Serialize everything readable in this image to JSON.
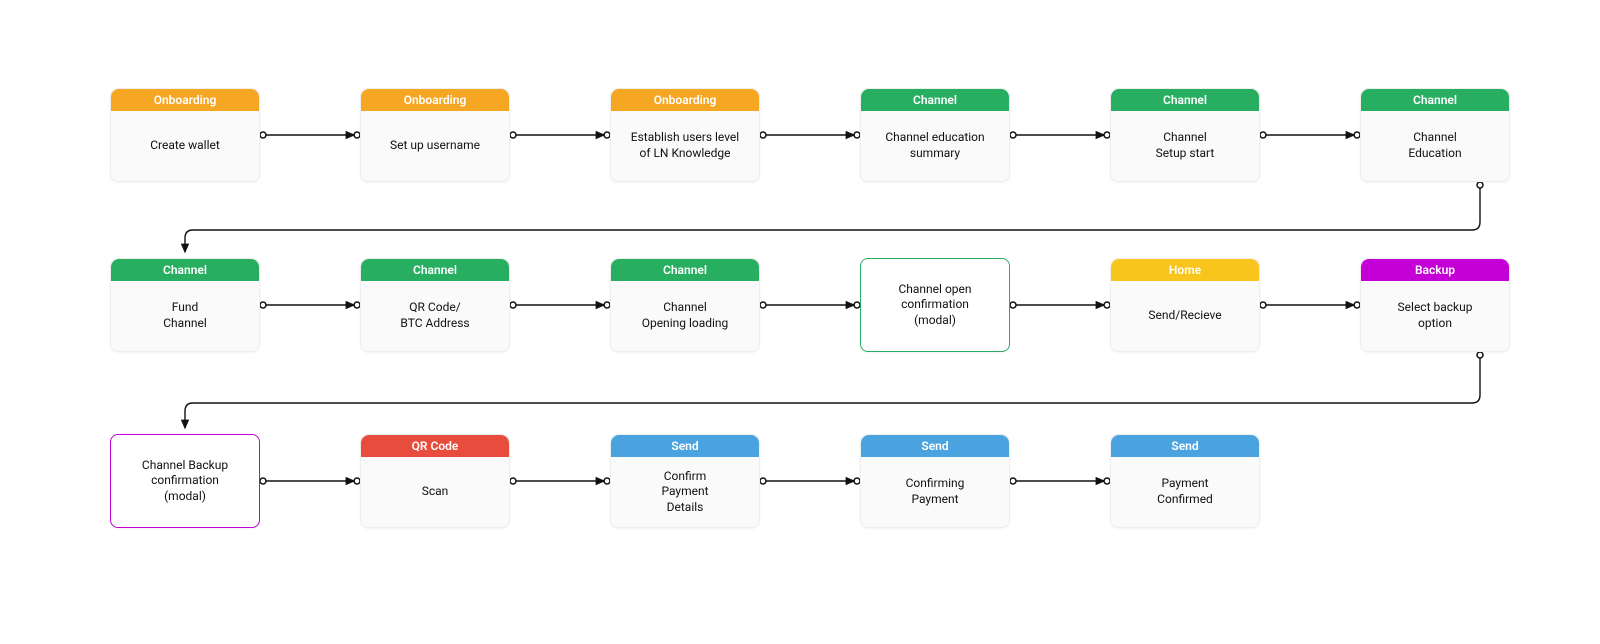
{
  "colors": {
    "orange": "#f5a623",
    "green": "#27ae60",
    "yellow": "#f8c51c",
    "magenta": "#c400d6",
    "purple": "#c400d6",
    "red": "#e74c3c",
    "blue": "#4aa3df",
    "line": "#111111"
  },
  "layout": {
    "nodeW": 150,
    "col_xs": [
      110,
      360,
      610,
      860,
      1110,
      1360
    ],
    "row_centers": [
      135,
      299,
      485
    ],
    "row_node_tops": [
      88,
      258,
      434
    ]
  },
  "nodes": [
    {
      "id": "r1c1",
      "row": 0,
      "col": 0,
      "type": "card",
      "head": "Onboarding",
      "body": "Create wallet",
      "color": "orange"
    },
    {
      "id": "r1c2",
      "row": 0,
      "col": 1,
      "type": "card",
      "head": "Onboarding",
      "body": "Set up username",
      "color": "orange"
    },
    {
      "id": "r1c3",
      "row": 0,
      "col": 2,
      "type": "card",
      "head": "Onboarding",
      "body": "Establish users level\nof LN Knowledge",
      "color": "orange"
    },
    {
      "id": "r1c4",
      "row": 0,
      "col": 3,
      "type": "card",
      "head": "Channel",
      "body": "Channel education\nsummary",
      "color": "green"
    },
    {
      "id": "r1c5",
      "row": 0,
      "col": 4,
      "type": "card",
      "head": "Channel",
      "body": "Channel\nSetup start",
      "color": "green"
    },
    {
      "id": "r1c6",
      "row": 0,
      "col": 5,
      "type": "card",
      "head": "Channel",
      "body": "Channel\nEducation",
      "color": "green"
    },
    {
      "id": "r2c1",
      "row": 1,
      "col": 0,
      "type": "card",
      "head": "Channel",
      "body": "Fund\nChannel",
      "color": "green"
    },
    {
      "id": "r2c2",
      "row": 1,
      "col": 1,
      "type": "card",
      "head": "Channel",
      "body": "QR Code/\nBTC Address",
      "color": "green"
    },
    {
      "id": "r2c3",
      "row": 1,
      "col": 2,
      "type": "card",
      "head": "Channel",
      "body": "Channel\nOpening loading",
      "color": "green"
    },
    {
      "id": "r2c4",
      "row": 1,
      "col": 3,
      "type": "modal",
      "border": "green",
      "body": "Channel open\nconfirmation\n(modal)"
    },
    {
      "id": "r2c5",
      "row": 1,
      "col": 4,
      "type": "card",
      "head": "Home",
      "body": "Send/Recieve",
      "color": "yellow"
    },
    {
      "id": "r2c6",
      "row": 1,
      "col": 5,
      "type": "card",
      "head": "Backup",
      "body": "Select backup\noption",
      "color": "magenta"
    },
    {
      "id": "r3c1",
      "row": 2,
      "col": 0,
      "type": "modal",
      "border": "purple",
      "body": "Channel Backup\nconfirmation\n(modal)"
    },
    {
      "id": "r3c2",
      "row": 2,
      "col": 1,
      "type": "card",
      "head": "QR Code",
      "body": "Scan",
      "color": "red"
    },
    {
      "id": "r3c3",
      "row": 2,
      "col": 2,
      "type": "card",
      "head": "Send",
      "body": "Confirm\nPayment\nDetails",
      "color": "blue"
    },
    {
      "id": "r3c4",
      "row": 2,
      "col": 3,
      "type": "card",
      "head": "Send",
      "body": "Confirming\nPayment",
      "color": "blue"
    },
    {
      "id": "r3c5",
      "row": 2,
      "col": 4,
      "type": "card",
      "head": "Send",
      "body": "Payment\nConfirmed",
      "color": "blue"
    }
  ],
  "edges": [
    [
      "r1c1",
      "r1c2",
      "h"
    ],
    [
      "r1c2",
      "r1c3",
      "h"
    ],
    [
      "r1c3",
      "r1c4",
      "h"
    ],
    [
      "r1c4",
      "r1c5",
      "h"
    ],
    [
      "r1c5",
      "r1c6",
      "h"
    ],
    [
      "r1c6",
      "r2c1",
      "wrap"
    ],
    [
      "r2c1",
      "r2c2",
      "h"
    ],
    [
      "r2c2",
      "r2c3",
      "h"
    ],
    [
      "r2c3",
      "r2c4",
      "h"
    ],
    [
      "r2c4",
      "r2c5",
      "h"
    ],
    [
      "r2c5",
      "r2c6",
      "h"
    ],
    [
      "r2c6",
      "r3c1",
      "wrap"
    ],
    [
      "r3c1",
      "r3c2",
      "h"
    ],
    [
      "r3c2",
      "r3c3",
      "h"
    ],
    [
      "r3c3",
      "r3c4",
      "h"
    ],
    [
      "r3c4",
      "r3c5",
      "h"
    ]
  ]
}
